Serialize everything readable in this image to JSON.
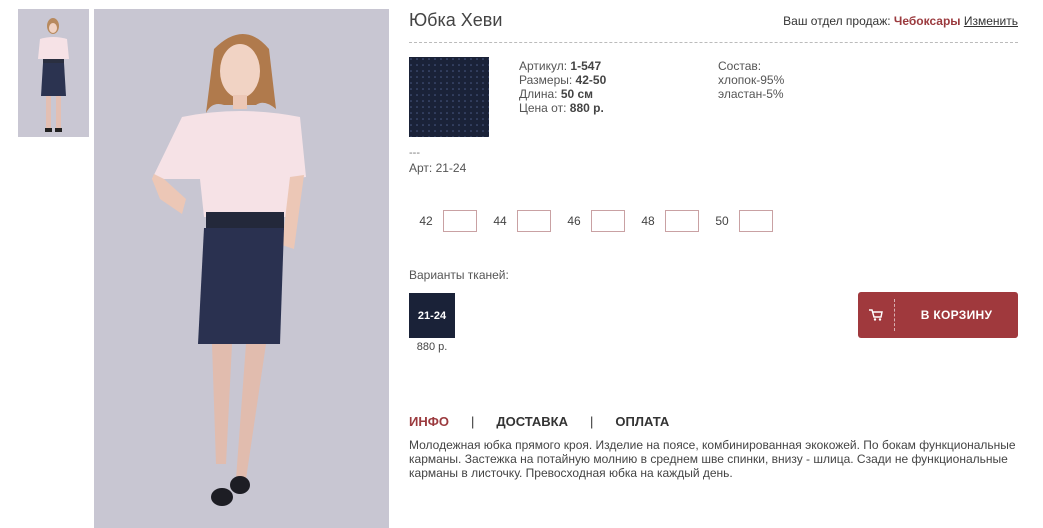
{
  "product": {
    "title": "Юбка Хеви",
    "article_label": "Артикул:",
    "article_value": "1-547",
    "sizes_label": "Размеры:",
    "sizes_value": "42-50",
    "length_label": "Длина:",
    "length_value": "50 см",
    "price_label": "Цена от:",
    "price_value": "880 р.",
    "composition_title": "Состав:",
    "composition": [
      "хлопок-95%",
      "эластан-5%"
    ],
    "dashes": "---",
    "art_line": "Арт: 21-24"
  },
  "dept": {
    "label": "Ваш отдел продаж:",
    "city": "Чебоксары",
    "change": "Изменить"
  },
  "sizes": [
    "42",
    "44",
    "46",
    "48",
    "50"
  ],
  "variants": {
    "label": "Варианты тканей:",
    "items": [
      {
        "code": "21-24",
        "price": "880 р."
      }
    ]
  },
  "cart": {
    "label": "В КОРЗИНУ",
    "icon": "cart-icon"
  },
  "tabs": [
    {
      "label": "ИНФО",
      "active": true
    },
    {
      "label": "ДОСТАВКА",
      "active": false
    },
    {
      "label": "ОПЛАТА",
      "active": false
    }
  ],
  "description": "Молодежная юбка прямого кроя. Изделие на поясе, комбинированная экокожей. По бокам функциональные карманы. Застежка на потайную молнию в среднем шве спинки, внизу - шлица. Сзади не функциональные карманы в листочку. Превосходная юбка на каждый день.",
  "colors": {
    "accent": "#a0393d",
    "fabric": "#1a2238",
    "photo_bg": "#c8c6d2"
  }
}
